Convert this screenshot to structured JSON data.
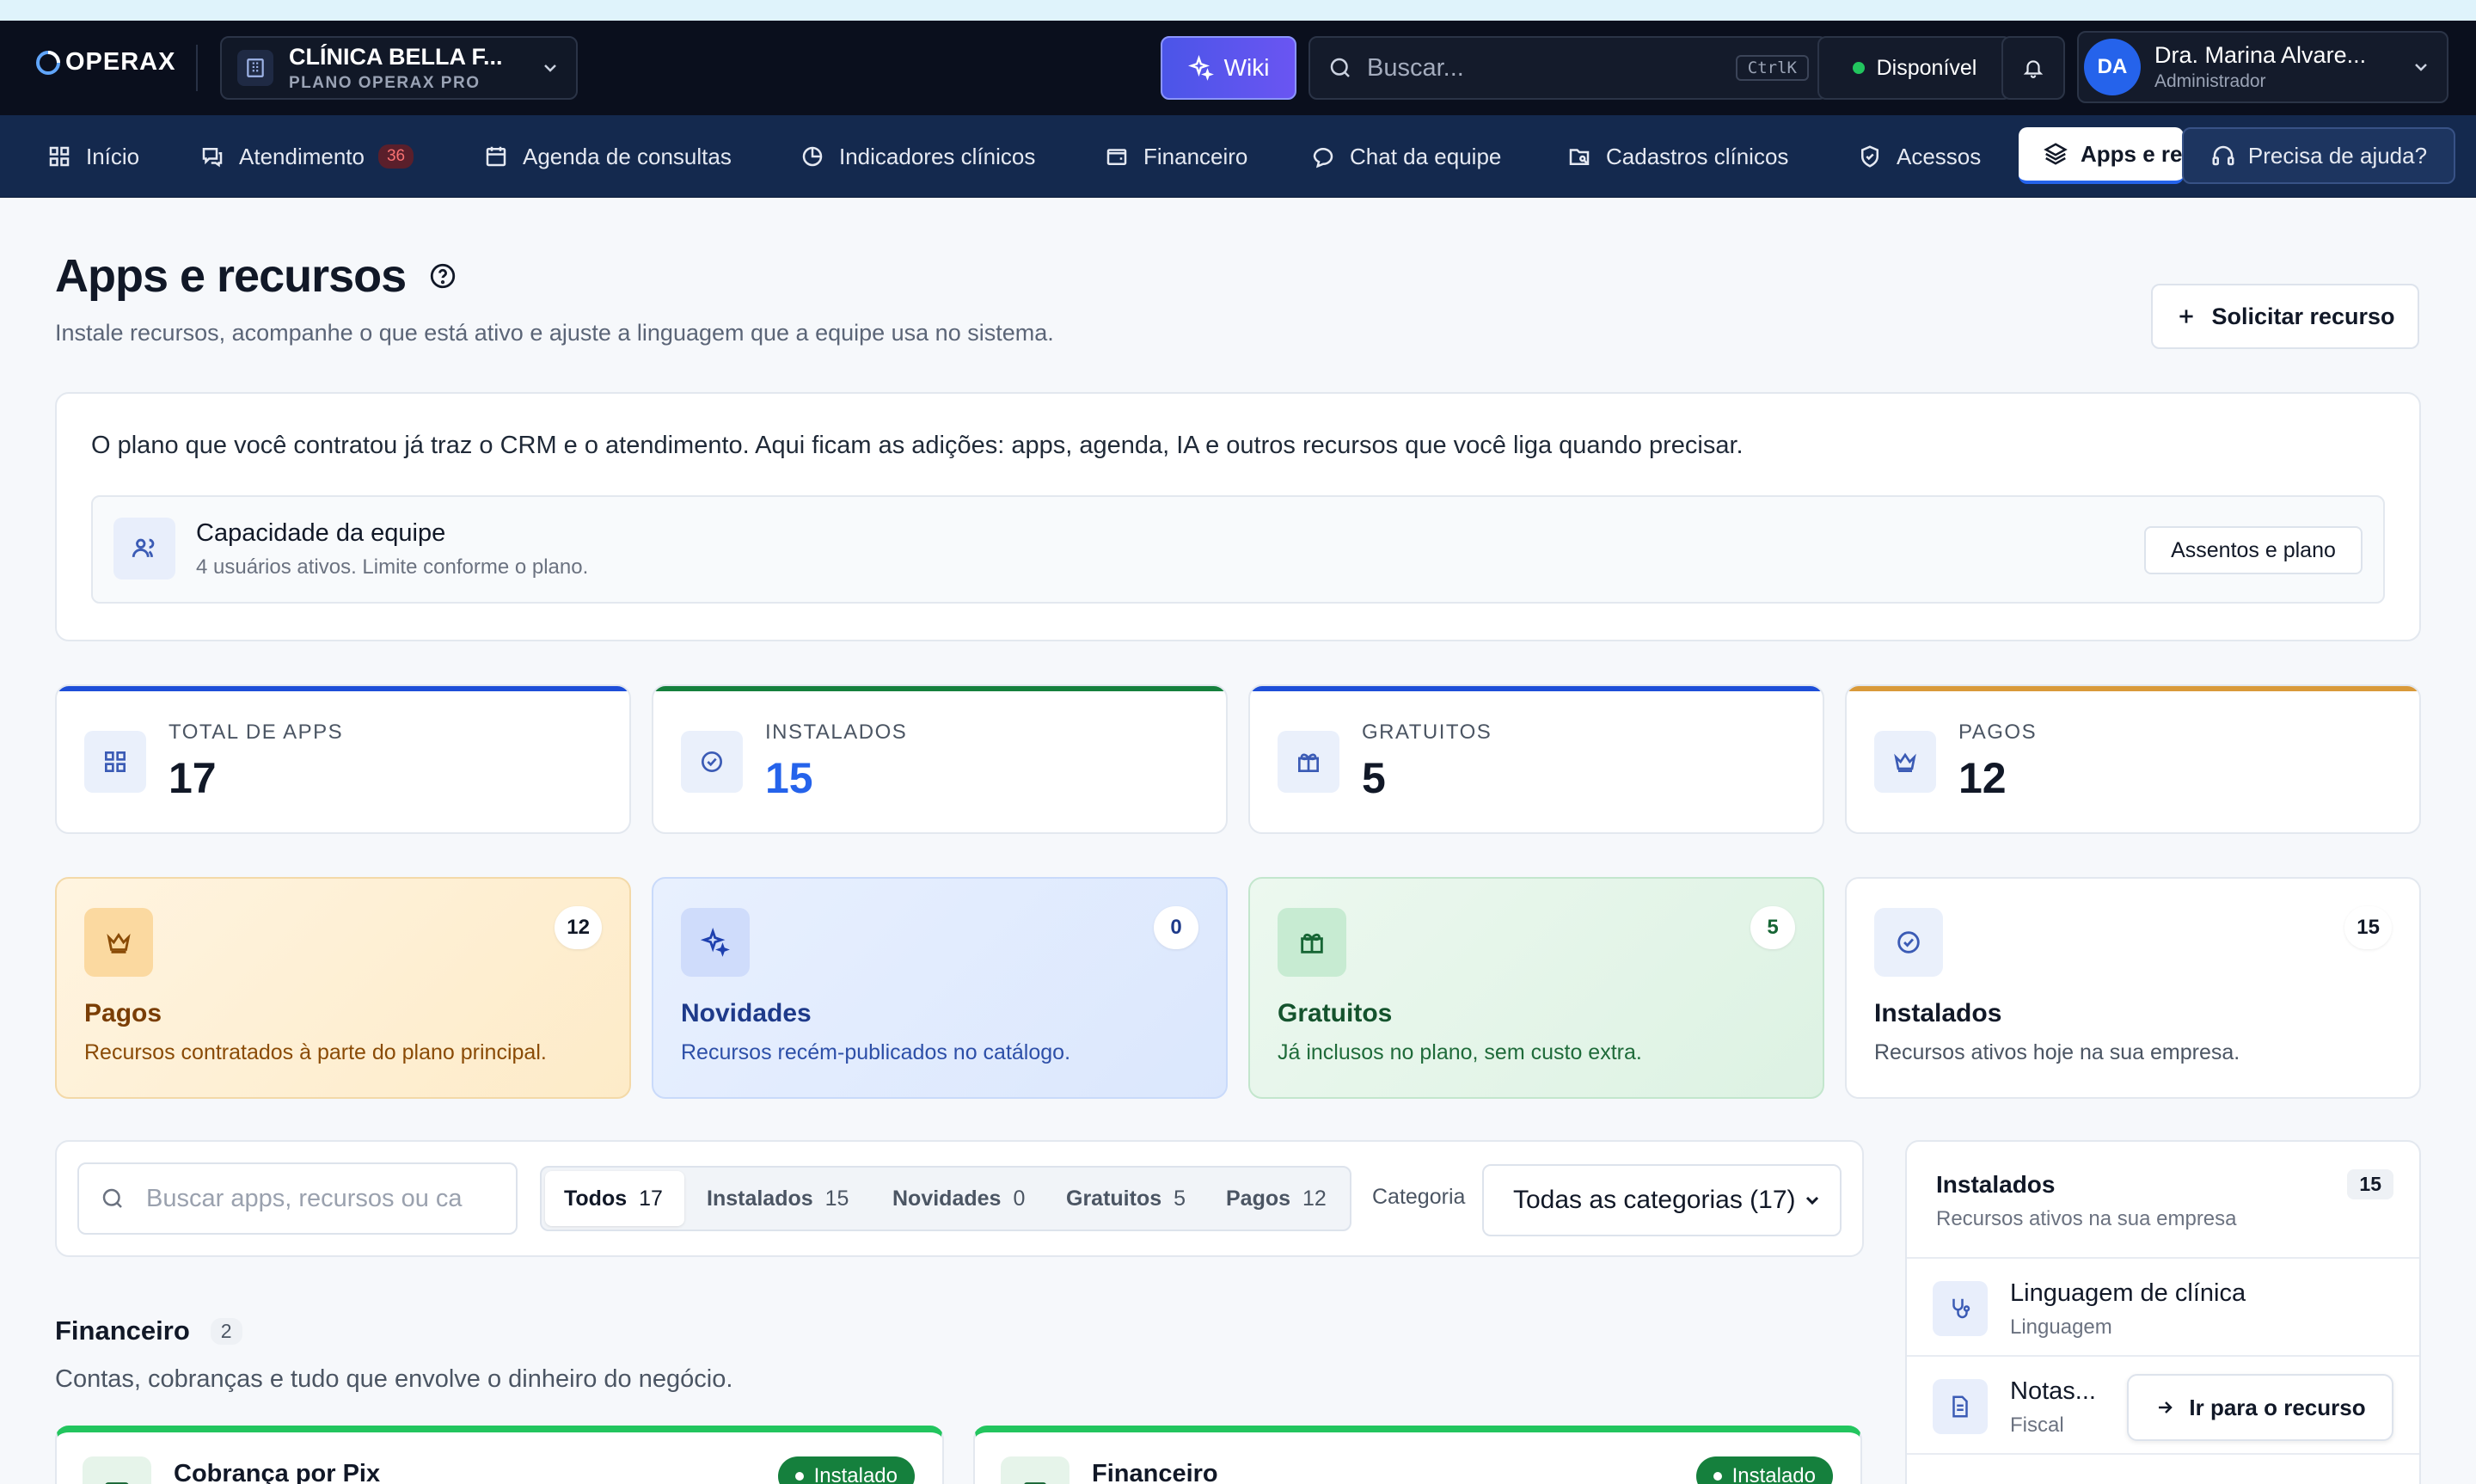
{
  "brand": {
    "logo_text": "OPERAX"
  },
  "org": {
    "name": "CLÍNICA BELLA F...",
    "plan": "PLANO OPERAX PRO"
  },
  "header": {
    "wiki_label": "Wiki",
    "search_placeholder": "Buscar...",
    "search_shortcut": "CtrlK",
    "status_label": "Disponível",
    "user_initials": "DA",
    "user_name": "Dra. Marina Alvare...",
    "user_role": "Administrador"
  },
  "nav": {
    "items": [
      {
        "label": "Início"
      },
      {
        "label": "Atendimento",
        "badge": "36"
      },
      {
        "label": "Agenda de consultas"
      },
      {
        "label": "Indicadores clínicos"
      },
      {
        "label": "Financeiro"
      },
      {
        "label": "Chat da equipe"
      },
      {
        "label": "Cadastros clínicos"
      },
      {
        "label": "Acessos"
      },
      {
        "label": "Apps e re"
      }
    ],
    "help_label": "Precisa de ajuda?"
  },
  "page": {
    "title": "Apps e recursos",
    "subtitle": "Instale recursos, acompanhe o que está ativo e ajuste a linguagem que a equipe usa no sistema.",
    "request_button": "Solicitar recurso"
  },
  "intro": {
    "text": "O plano que você contratou já traz o CRM e o atendimento. Aqui ficam as adições: apps, agenda, IA e outros recursos que você liga quando precisar.",
    "capacity_title": "Capacidade da equipe",
    "capacity_sub": "4 usuários ativos. Limite conforme o plano.",
    "capacity_button": "Assentos e plano"
  },
  "stats": [
    {
      "label": "TOTAL DE APPS",
      "value": "17",
      "color": "#1d4ed8"
    },
    {
      "label": "INSTALADOS",
      "value": "15",
      "color": "#15803d"
    },
    {
      "label": "GRATUITOS",
      "value": "5",
      "color": "#1d4ed8"
    },
    {
      "label": "PAGOS",
      "value": "12",
      "color": "#d97706"
    }
  ],
  "categories": [
    {
      "title": "Pagos",
      "desc": "Recursos contratados à parte do plano principal.",
      "count": "12"
    },
    {
      "title": "Novidades",
      "desc": "Recursos recém-publicados no catálogo.",
      "count": "0"
    },
    {
      "title": "Gratuitos",
      "desc": "Já inclusos no plano, sem custo extra.",
      "count": "5"
    },
    {
      "title": "Instalados",
      "desc": "Recursos ativos hoje na sua empresa.",
      "count": "15"
    }
  ],
  "filters": {
    "search_placeholder": "Buscar apps, recursos ou ca",
    "tabs": [
      {
        "label": "Todos",
        "count": "17"
      },
      {
        "label": "Instalados",
        "count": "15"
      },
      {
        "label": "Novidades",
        "count": "0"
      },
      {
        "label": "Gratuitos",
        "count": "5"
      },
      {
        "label": "Pagos",
        "count": "12"
      }
    ],
    "category_label": "Categoria",
    "category_value": "Todas as categorias (17)"
  },
  "section": {
    "title": "Financeiro",
    "count": "2",
    "subtitle": "Contas, cobranças e tudo que envolve o dinheiro do negócio.",
    "apps": [
      {
        "title": "Cobrança por Pix",
        "status": "Instalado"
      },
      {
        "title": "Financeiro",
        "status": "Instalado"
      }
    ]
  },
  "sidebar": {
    "title": "Instalados",
    "subtitle": "Recursos ativos na sua empresa",
    "count": "15",
    "items": [
      {
        "name": "Linguagem de clínica",
        "meta": "Linguagem"
      },
      {
        "name": "Notas...",
        "meta": "Fiscal",
        "action": "Ir para o recurso"
      }
    ]
  }
}
